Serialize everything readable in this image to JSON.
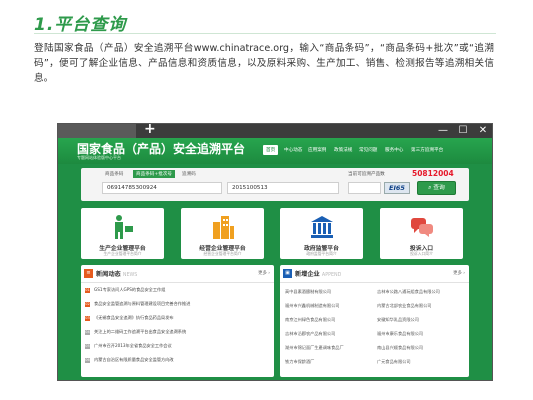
{
  "document": {
    "heading": "1.平台查询",
    "paragraph": "登陆国家食品（产品）安全追溯平台www.chinatrace.org，输入“商品条码”，“商品条码+批次”或“追溯码”，便可了解企业信息、产品信息和资质信息，以及原料采购、生产加工、销售、检测报告等追溯相关信息。"
  },
  "browser": {
    "new_tab_symbol": "+",
    "minimize_symbol": "—",
    "maximize_symbol": "☐",
    "close_symbol": "✕"
  },
  "site": {
    "title": "国家食品（产品）安全追溯平台",
    "slogan": "专题网站体验版中心平台",
    "nav": [
      "首页",
      "中心动态",
      "应用案例",
      "政策法规",
      "常见问题",
      "服务中心",
      "第三方追溯平台"
    ]
  },
  "search": {
    "tabs": [
      "商品条码",
      "商品条码+批次号",
      "追溯码"
    ],
    "barcode_value": "06914785300924",
    "batch_value": "2015100513",
    "count_label": "当前可追溯产品数",
    "count_value": "50812004",
    "captcha_text": "EI65",
    "query_button": "查询"
  },
  "tiles": [
    {
      "label": "生产企业管理平台",
      "sub": "生产企业管理平台简介"
    },
    {
      "label": "经营企业管理平台",
      "sub": "经营企业管理平台简介"
    },
    {
      "label": "政府监管平台",
      "sub": "政府监管平台简介"
    },
    {
      "label": "投诉入口",
      "sub": "投诉入口简介"
    }
  ],
  "news": {
    "title": "新闻动态",
    "title_en": "NEWS",
    "more": "更多 ›",
    "items": [
      {
        "badge": "01",
        "text": "GS1专家访问人GPS的食品安全工作组"
      },
      {
        "badge": "02",
        "text": "食品安全监管追溯与原料管理建设项目完善合作推进"
      },
      {
        "badge": "03",
        "text": "《无锡食品安全追溯》执行食品药品局发布"
      },
      {
        "badge": "04",
        "text": "关注上的二维码工作追溯平台出食品安全追溯系统"
      },
      {
        "badge": "05",
        "text": "广州市召开2013年全省食品安全工作会议"
      },
      {
        "badge": "06",
        "text": "内蒙古自治区有限质量食品安全监管方向改"
      }
    ]
  },
  "new_companies": {
    "title": "新增企业",
    "title_en": "APPEND",
    "more": "更多 ›",
    "col1": [
      "高中县素酒酿制有限公司",
      "福州市兴鑫机械制造有限公司",
      "南京江州绿色食品有限公司",
      "吉林市沿郡农产品有限公司",
      "湖州市锦记面厂生產调味食品厂",
      "铁力市保龄酒厂"
    ],
    "col2": [
      "吉林市公路八通玩组食品有限公司",
      "内蒙古北部农业食品有限公司",
      "安徽知华乳品资限公司",
      "福州市康乐食品有限公司",
      "南山县兴顺食品有限公司",
      "广元食品有限公司"
    ]
  },
  "colors": {
    "brand_green": "#2e9a4b",
    "count_red": "#e6192b"
  }
}
